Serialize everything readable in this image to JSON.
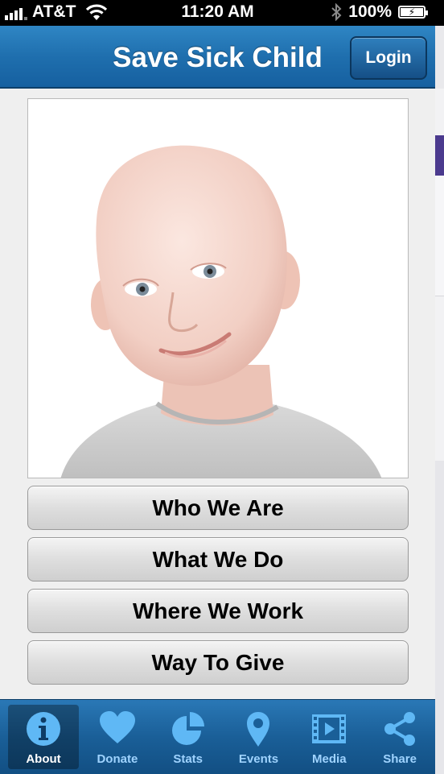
{
  "status_bar": {
    "carrier": "AT&T",
    "time": "11:20 AM",
    "battery": "100%"
  },
  "header": {
    "title": "Save Sick Child",
    "login_label": "Login"
  },
  "hero_image": {
    "subject": "smiling bald child"
  },
  "menu": {
    "items": [
      {
        "label": "Who We Are"
      },
      {
        "label": "What We Do"
      },
      {
        "label": "Where We Work"
      },
      {
        "label": "Way To Give"
      }
    ]
  },
  "tab_bar": {
    "tabs": [
      {
        "label": "About",
        "icon": "info-icon",
        "active": true
      },
      {
        "label": "Donate",
        "icon": "heart-icon",
        "active": false
      },
      {
        "label": "Stats",
        "icon": "pie-chart-icon",
        "active": false
      },
      {
        "label": "Events",
        "icon": "map-pin-icon",
        "active": false
      },
      {
        "label": "Media",
        "icon": "film-icon",
        "active": false
      },
      {
        "label": "Share",
        "icon": "share-icon",
        "active": false
      }
    ]
  },
  "colors": {
    "nav_blue": "#1f6fae",
    "tab_icon": "#5fb8f5",
    "tab_label": "#9fd3ff"
  }
}
